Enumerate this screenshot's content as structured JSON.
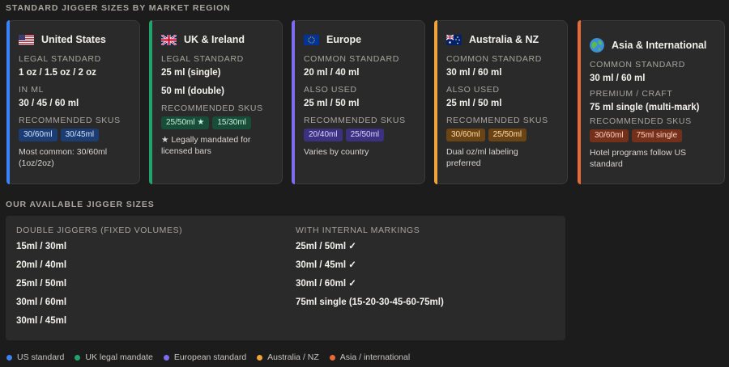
{
  "header": {
    "title": "STANDARD JIGGER SIZES BY MARKET REGION"
  },
  "regions": [
    {
      "name": "United States",
      "flag": "us-flag-icon",
      "color": "#3b82f6",
      "label1": "LEGAL STANDARD",
      "value1": "1 oz / 1.5 oz / 2 oz",
      "label2": "IN ML",
      "value2": "30 / 45 / 60 ml",
      "label3": "RECOMMENDED SKUS",
      "skus": [
        "30/60ml",
        "30/45ml"
      ],
      "note": "Most common: 30/60ml (1oz/2oz)"
    },
    {
      "name": "UK & Ireland",
      "flag": "uk-flag-icon",
      "color": "#22a36b",
      "label1": "LEGAL STANDARD",
      "value1": "25 ml (single)",
      "value2": "50 ml (double)",
      "label3": "RECOMMENDED SKUS",
      "skus": [
        "25/50ml ★",
        "15/30ml"
      ],
      "note": "★ Legally mandated for licensed bars"
    },
    {
      "name": "Europe",
      "flag": "eu-flag-icon",
      "color": "#7c6cf0",
      "label1": "COMMON STANDARD",
      "value1": "20 ml / 40 ml",
      "label2": "ALSO USED",
      "value2": "25 ml / 50 ml",
      "label3": "RECOMMENDED SKUS",
      "skus": [
        "20/40ml",
        "25/50ml"
      ],
      "note": "Varies by country"
    },
    {
      "name": "Australia & NZ",
      "flag": "au-flag-icon",
      "color": "#f0a33a",
      "label1": "COMMON STANDARD",
      "value1": "30 ml / 60 ml",
      "label2": "ALSO USED",
      "value2": "25 ml / 50 ml",
      "label3": "RECOMMENDED SKUS",
      "skus": [
        "30/60ml",
        "25/50ml"
      ],
      "note": "Dual oz/ml labeling preferred"
    },
    {
      "name": "Asia & International",
      "flag": "globe-icon",
      "color": "#e86a3a",
      "label1": "COMMON STANDARD",
      "value1": "30 ml / 60 ml",
      "label2": "PREMIUM / CRAFT",
      "value2": "75 ml single (multi-mark)",
      "label3": "RECOMMENDED SKUS",
      "skus": [
        "30/60ml",
        "75ml single"
      ],
      "note": "Hotel programs follow US standard"
    }
  ],
  "available": {
    "title": "OUR AVAILABLE JIGGER SIZES",
    "double_header": "DOUBLE JIGGERS (FIXED VOLUMES)",
    "double": [
      "15ml / 30ml",
      "20ml / 40ml",
      "25ml / 50ml",
      "30ml / 60ml",
      "30ml / 45ml"
    ],
    "marked_header": "WITH INTERNAL MARKINGS",
    "marked": [
      "25ml / 50ml ✓",
      "30ml / 45ml ✓",
      "30ml / 60ml ✓",
      "75ml single (15-20-30-45-60-75ml)"
    ]
  },
  "legend": [
    {
      "label": "US standard",
      "color": "#3b82f6"
    },
    {
      "label": "UK legal mandate",
      "color": "#22a36b"
    },
    {
      "label": "European standard",
      "color": "#7c6cf0"
    },
    {
      "label": "Australia / NZ",
      "color": "#f0a33a"
    },
    {
      "label": "Asia / international",
      "color": "#e86a3a"
    }
  ],
  "badge_colors": {
    "us": {
      "bg": "#1c3d73",
      "fg": "#cfe0ff"
    },
    "uk": {
      "bg": "#174d39",
      "fg": "#c8f0da"
    },
    "eu": {
      "bg": "#3a3180",
      "fg": "#dcd6ff"
    },
    "au": {
      "bg": "#6b4413",
      "fg": "#ffdcae"
    },
    "asia": {
      "bg": "#74301b",
      "fg": "#ffd2bf"
    }
  }
}
